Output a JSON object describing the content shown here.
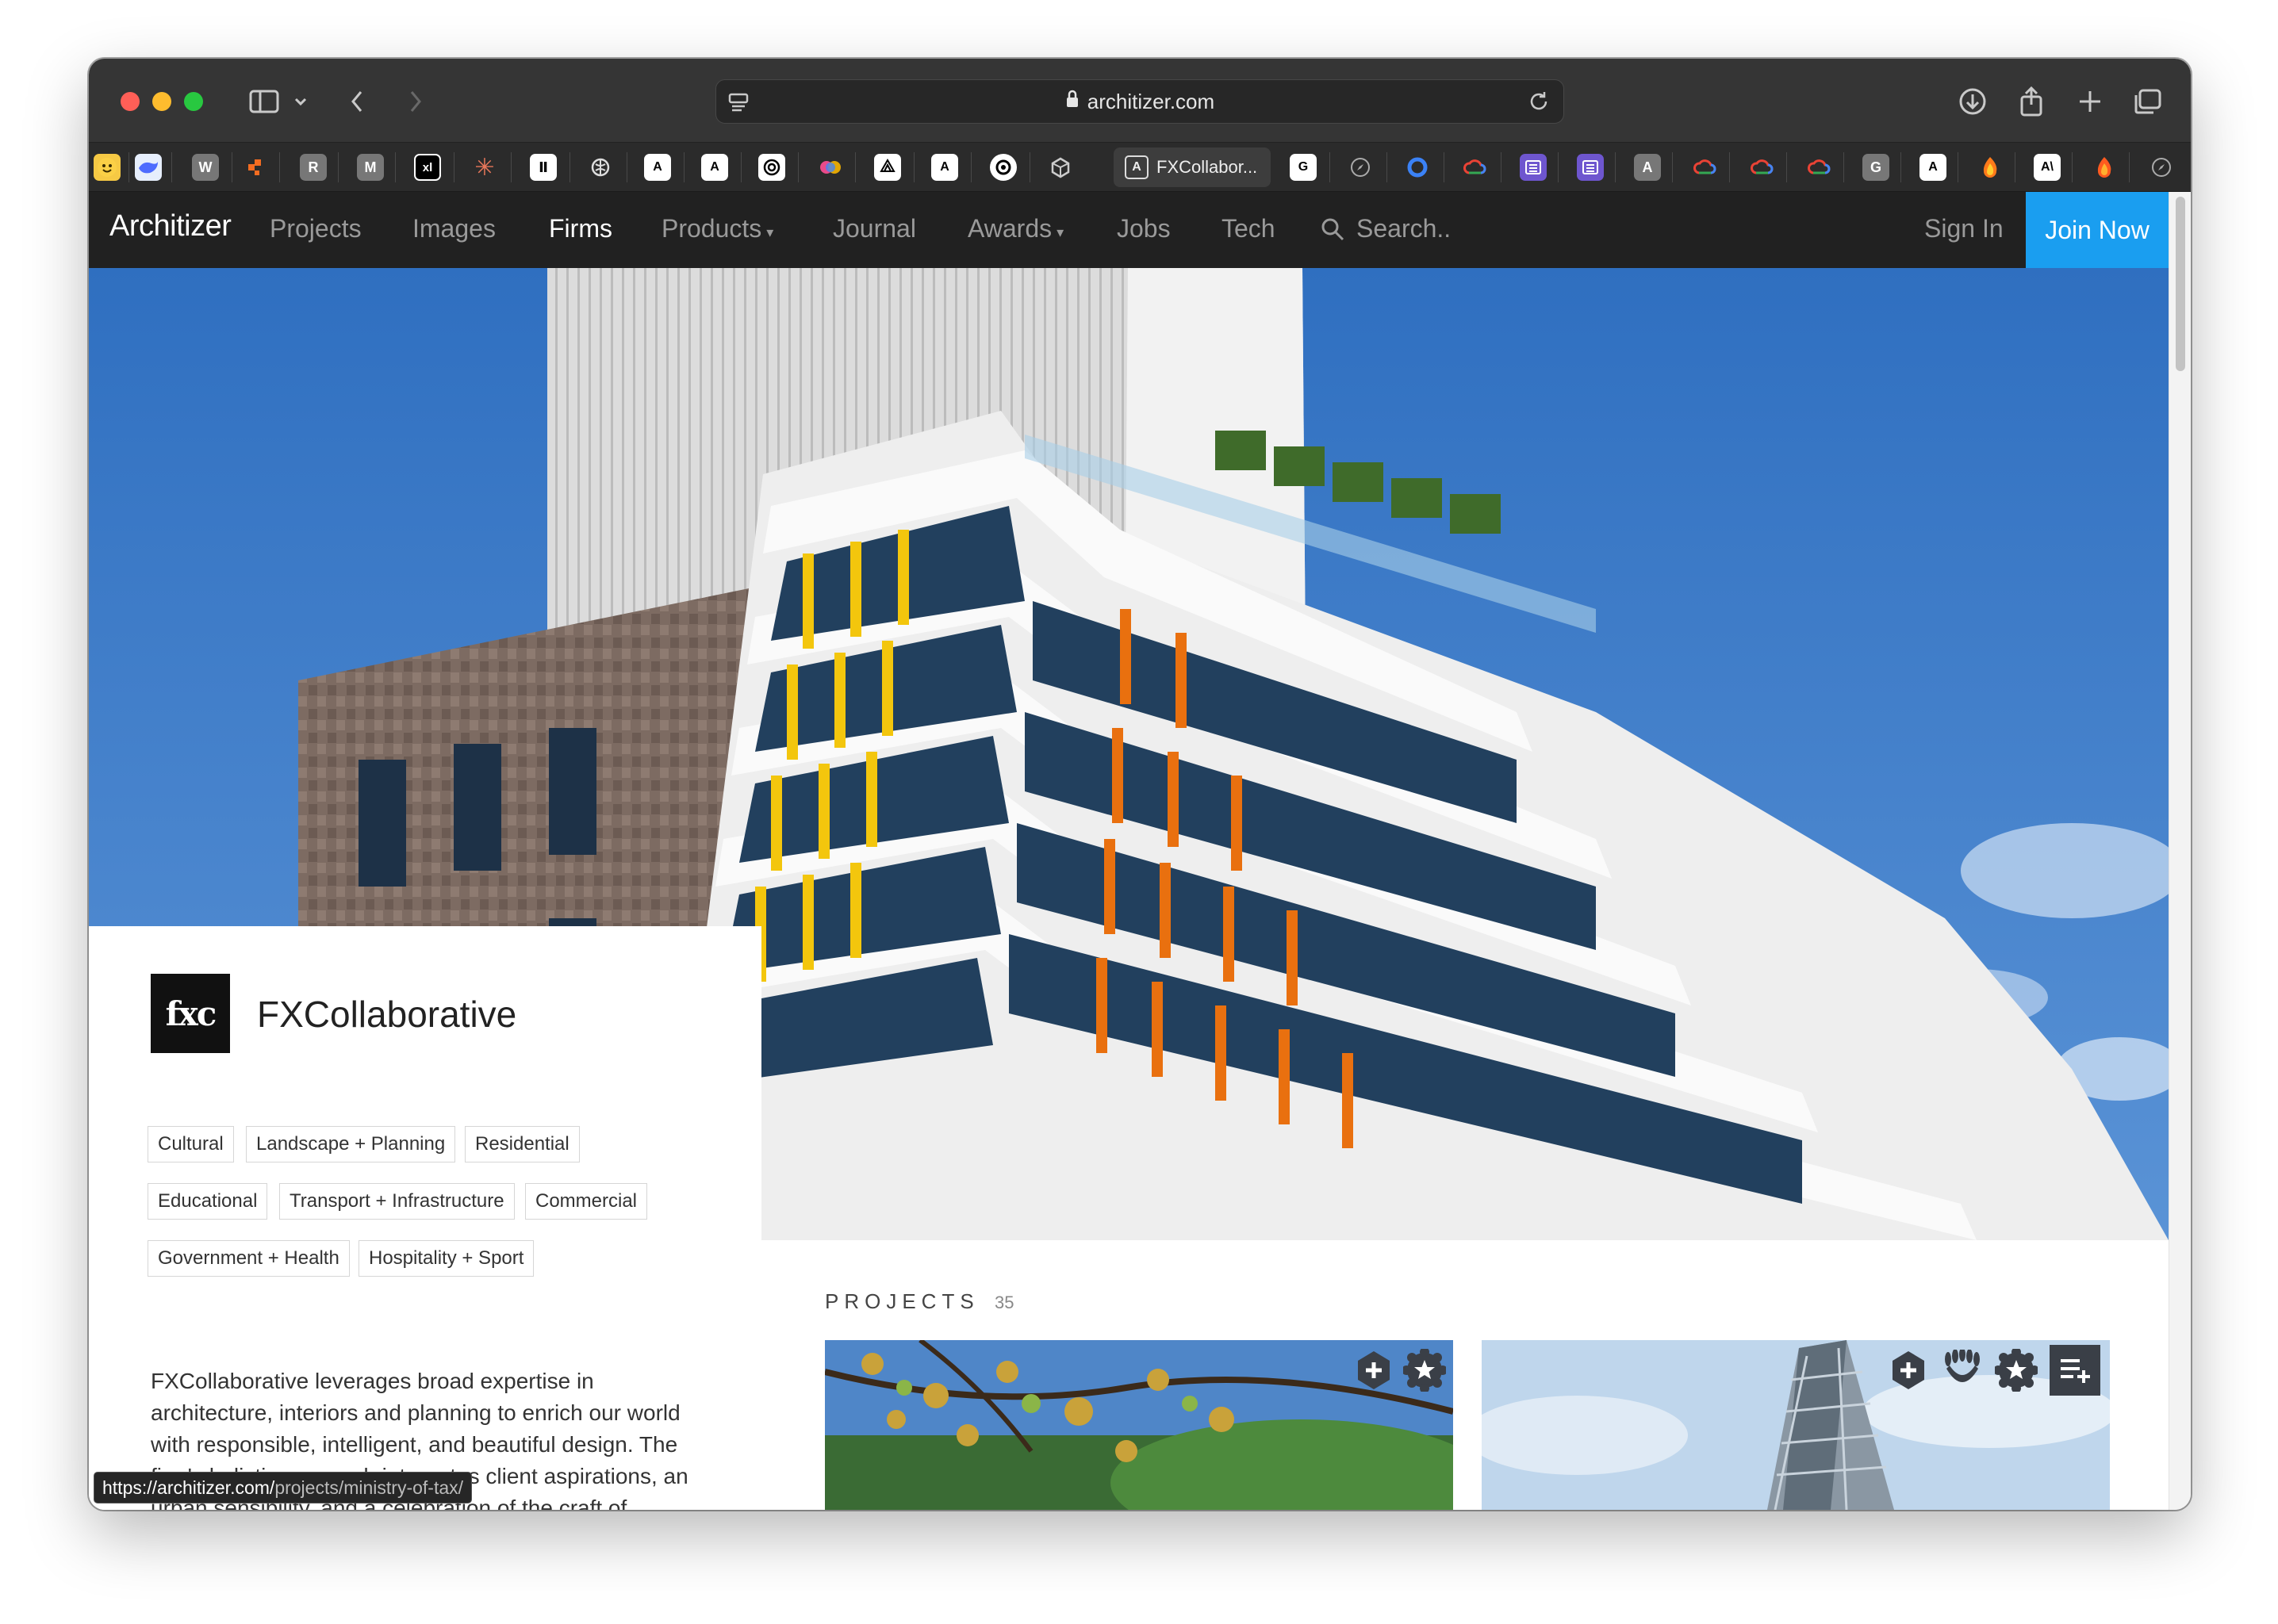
{
  "browser": {
    "url": "architizer.com",
    "active_tab_title": "FXCollabor...",
    "status_url_prefix": "https://architizer.com/",
    "status_url_suffix": "projects/ministry-of-tax/",
    "favorites": [
      "W",
      "R",
      "M",
      "xl",
      "A",
      "A",
      "A",
      "G",
      "A",
      "G",
      "A"
    ]
  },
  "nav": {
    "logo": "Architizer",
    "items": [
      {
        "label": "Projects",
        "active": false,
        "caret": false
      },
      {
        "label": "Images",
        "active": false,
        "caret": false
      },
      {
        "label": "Firms",
        "active": true,
        "caret": false
      },
      {
        "label": "Products",
        "active": false,
        "caret": true
      },
      {
        "label": "Journal",
        "active": false,
        "caret": false
      },
      {
        "label": "Awards",
        "active": false,
        "caret": true
      },
      {
        "label": "Jobs",
        "active": false,
        "caret": false
      },
      {
        "label": "Tech",
        "active": false,
        "caret": false
      }
    ],
    "search_placeholder": "Search..",
    "sign_in": "Sign In",
    "join_now": "Join Now",
    "caret_glyph": "▾"
  },
  "firm": {
    "logo_text": "fxc",
    "name": "FXCollaborative",
    "tags": [
      "Cultural",
      "Landscape + Planning",
      "Residential",
      "Educational",
      "Transport + Infrastructure",
      "Commercial",
      "Government + Health",
      "Hospitality + Sport"
    ],
    "description": "FXCollaborative leverages broad expertise in architecture, interiors and planning to enrich our world with responsible, intelligent, and beautiful design. The firm's holistic approach integrates client aspirations, an urban sensibility, and a celebration of the craft of"
  },
  "projects": {
    "label": "PROJECTS",
    "count": "35"
  },
  "colors": {
    "nav_bg": "#212121",
    "accent": "#1a9ef0",
    "sky": "#3f7cc7"
  }
}
